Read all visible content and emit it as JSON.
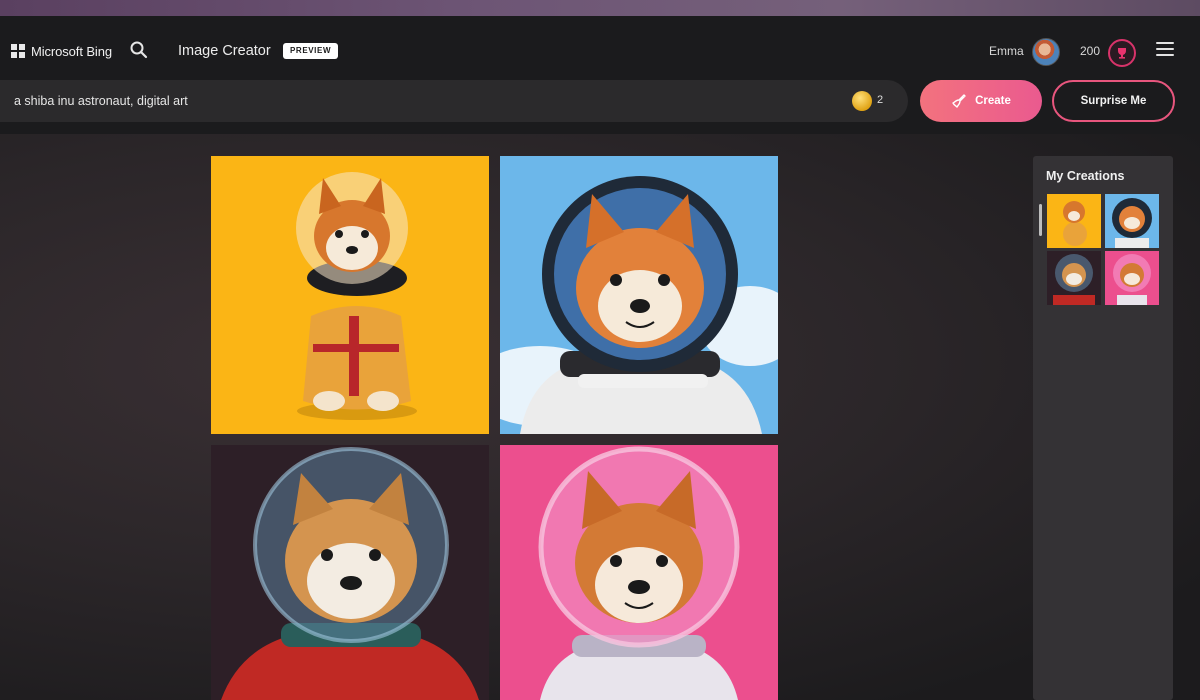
{
  "header": {
    "brand": "Microsoft Bing",
    "app_title": "Image Creator",
    "badge": "PREVIEW",
    "user_name": "Emma",
    "reward_points": "200"
  },
  "prompt": {
    "value": "a shiba inu astronaut, digital art",
    "boosts": "2"
  },
  "actions": {
    "create_label": "Create",
    "surprise_label": "Surprise Me"
  },
  "gallery": {
    "images": [
      {
        "name": "shiba-astronaut-yellow",
        "background": "#fbb515"
      },
      {
        "name": "shiba-astronaut-sky",
        "background": "#6cb7ea"
      },
      {
        "name": "shiba-astronaut-dark",
        "background": "#2d1f27"
      },
      {
        "name": "shiba-astronaut-pink",
        "background": "#ec4f8e"
      }
    ]
  },
  "sidebar": {
    "title": "My Creations"
  },
  "colors": {
    "accent": "#ea5a8f",
    "header_bg": "#1b1b1d",
    "panel_bg": "#343235"
  }
}
